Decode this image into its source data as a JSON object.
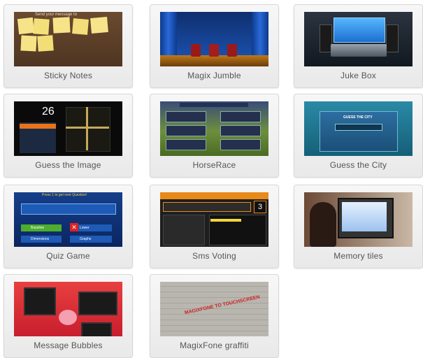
{
  "cards": [
    {
      "title": "Sticky Notes",
      "caption": "Send your message to"
    },
    {
      "title": "Magix Jumble"
    },
    {
      "title": "Juke Box"
    },
    {
      "title": "Guess the Image",
      "score": "26"
    },
    {
      "title": "HorseRace"
    },
    {
      "title": "Guess the City",
      "heading": "GUESS THE CITY"
    },
    {
      "title": "Quiz Game",
      "heading": "Press 1 to get next Question!",
      "options": [
        "Baseline",
        "Lower",
        "Dimensions",
        "Graphs"
      ]
    },
    {
      "title": "Sms Voting",
      "number": "3"
    },
    {
      "title": "Memory tiles"
    },
    {
      "title": "Message Bubbles"
    },
    {
      "title": "MagixFone graffiti",
      "graffiti": "MAGIXFONE TO TOUCHSCREEN"
    }
  ]
}
